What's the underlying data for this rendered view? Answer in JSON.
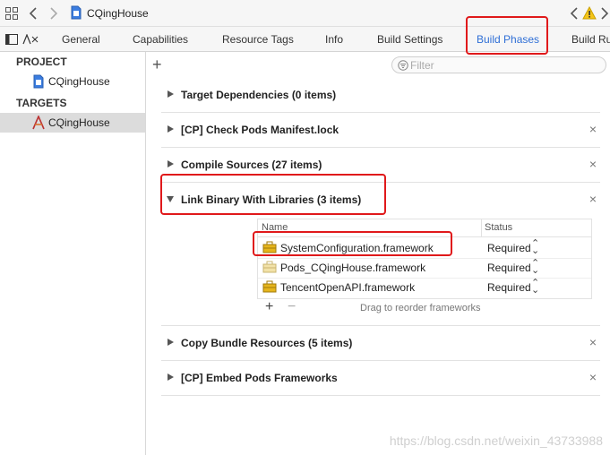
{
  "window": {
    "breadcrumb_project": "CQingHouse"
  },
  "tabs": [
    {
      "label": "General"
    },
    {
      "label": "Capabilities"
    },
    {
      "label": "Resource Tags"
    },
    {
      "label": "Info"
    },
    {
      "label": "Build Settings"
    },
    {
      "label": "Build Phases",
      "active": true
    },
    {
      "label": "Build Ru"
    }
  ],
  "sidebar": {
    "project_header": "PROJECT",
    "project_item": "CQingHouse",
    "targets_header": "TARGETS",
    "target_item": "CQingHouse"
  },
  "filter": {
    "placeholder": "Filter"
  },
  "phases": [
    {
      "title": "Target Dependencies (0 items)",
      "expanded": false,
      "removable": false
    },
    {
      "title": "[CP] Check Pods Manifest.lock",
      "expanded": false,
      "removable": true
    },
    {
      "title": "Compile Sources (27 items)",
      "expanded": false,
      "removable": true
    },
    {
      "title": "Link Binary With Libraries (3 items)",
      "expanded": true,
      "removable": true
    },
    {
      "title": "Copy Bundle Resources (5 items)",
      "expanded": false,
      "removable": true
    },
    {
      "title": "[CP] Embed Pods Frameworks",
      "expanded": false,
      "removable": true
    }
  ],
  "libraries": {
    "col_name": "Name",
    "col_status": "Status",
    "rows": [
      {
        "name": "SystemConfiguration.framework",
        "status": "Required"
      },
      {
        "name": "Pods_CQingHouse.framework",
        "status": "Required"
      },
      {
        "name": "TencentOpenAPI.framework",
        "status": "Required"
      }
    ],
    "drag_hint": "Drag to reorder frameworks"
  },
  "watermark": "https://blog.csdn.net/weixin_43733988",
  "colors": {
    "accent": "#2f6fd6",
    "highlight": "#e0191b",
    "warning": "#f5c518"
  }
}
